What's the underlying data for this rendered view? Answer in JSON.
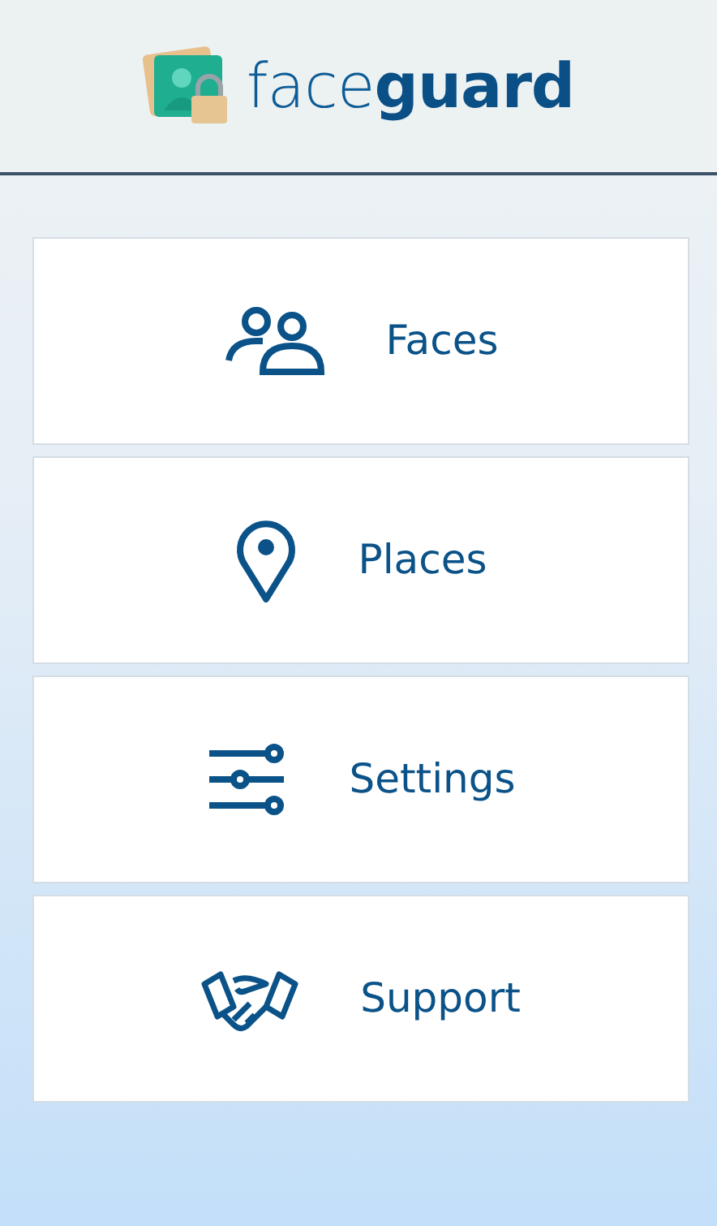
{
  "header": {
    "logo_text": "face**guard**"
  },
  "menu": [
    {
      "kind": "faces",
      "label": "Faces"
    },
    {
      "kind": "places",
      "label": "Places"
    },
    {
      "kind": "settings",
      "label": "Settings"
    },
    {
      "kind": "support",
      "label": "Support"
    }
  ]
}
